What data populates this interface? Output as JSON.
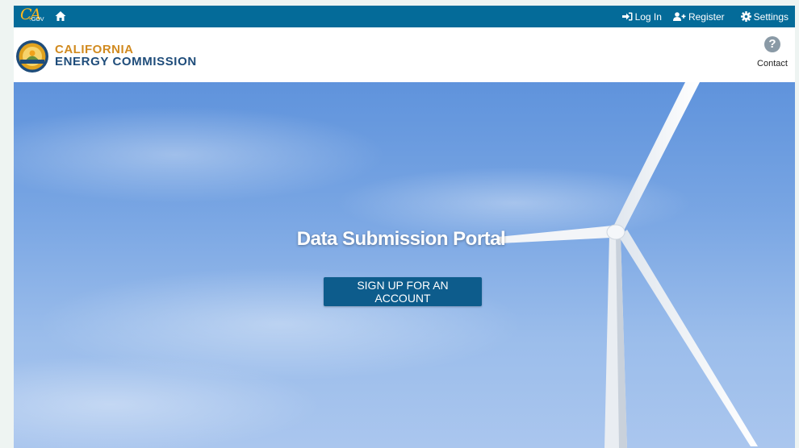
{
  "topbar": {
    "logo_text": "CA",
    "logo_suffix": ".GOV",
    "links": {
      "login": "Log In",
      "register": "Register",
      "settings": "Settings"
    }
  },
  "header": {
    "brand_line1": "CALIFORNIA",
    "brand_line2": "ENERGY COMMISSION",
    "contact_label": "Contact",
    "contact_icon_glyph": "?"
  },
  "hero": {
    "title": "Data Submission Portal",
    "cta_label": "SIGN UP FOR AN ACCOUNT"
  },
  "colors": {
    "topbar": "#046b99",
    "brand_gold": "#d18a1f",
    "brand_blue": "#1e4c7a",
    "cta": "#0d5c8c"
  }
}
